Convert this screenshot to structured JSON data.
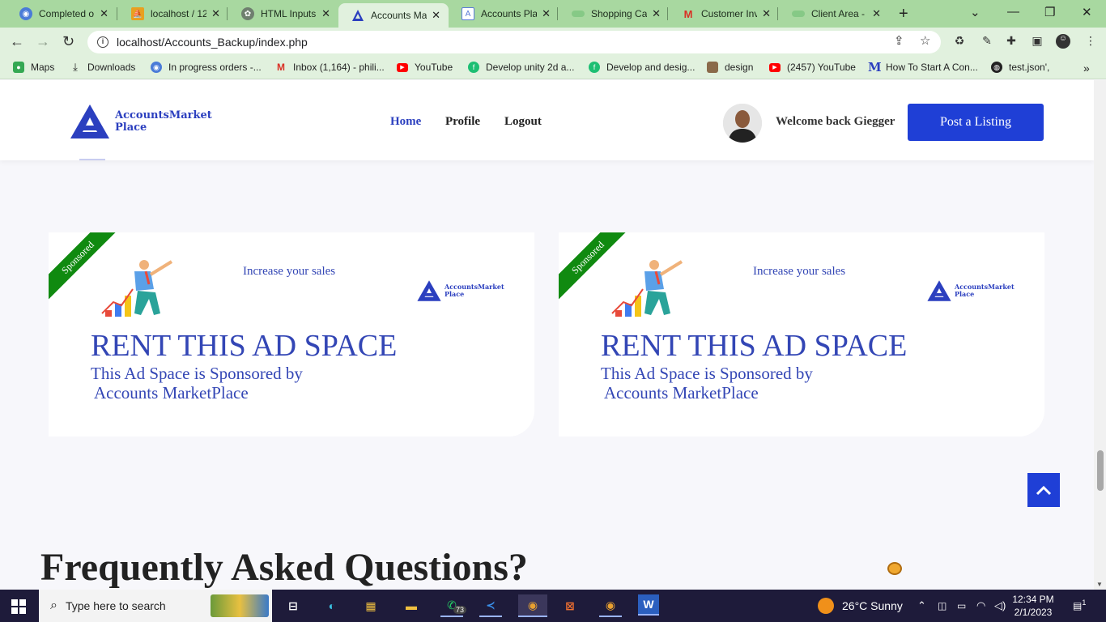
{
  "browser": {
    "tabs": [
      {
        "label": "Completed o",
        "icon": "chat-icon",
        "color": "#4a7bd8"
      },
      {
        "label": "localhost / 12",
        "icon": "phpmyadmin-icon",
        "color": "#e8a020"
      },
      {
        "label": "HTML Inputs",
        "icon": "openai-icon",
        "color": "#6f7f6f"
      },
      {
        "label": "Accounts Ma",
        "icon": "accounts-logo-icon",
        "color": "#2b3fbf"
      },
      {
        "label": "Accounts Pla",
        "icon": "page-icon",
        "color": "#5a7ad8"
      },
      {
        "label": "Shopping Ca",
        "icon": "cloud-icon",
        "color": "#86c986"
      },
      {
        "label": "Customer Inv",
        "icon": "gmail-icon",
        "color": "#d93025"
      },
      {
        "label": "Client Area -",
        "icon": "cloud-icon",
        "color": "#86c986"
      }
    ],
    "active_tab_index": 3,
    "url": "localhost/Accounts_Backup/index.php",
    "bookmarks": [
      {
        "label": "Maps",
        "icon": "maps-icon",
        "color": "#34a853"
      },
      {
        "label": "Downloads",
        "icon": "download-icon",
        "color": "#333333"
      },
      {
        "label": "In progress orders -...",
        "icon": "chat-icon",
        "color": "#4a7bd8"
      },
      {
        "label": "Inbox (1,164) - phili...",
        "icon": "gmail-icon",
        "color": "#d93025"
      },
      {
        "label": "YouTube",
        "icon": "youtube-icon",
        "color": "#ff0000"
      },
      {
        "label": "Develop unity 2d a...",
        "icon": "fiverr-icon",
        "color": "#1dbf73"
      },
      {
        "label": "Develop and desig...",
        "icon": "fiverr-icon",
        "color": "#1dbf73"
      },
      {
        "label": "design",
        "icon": "avatar-icon",
        "color": "#8a6a4a"
      },
      {
        "label": "(2457) YouTube",
        "icon": "youtube-icon",
        "color": "#ff0000"
      },
      {
        "label": "How To Start A Con...",
        "icon": "medium-icon",
        "color": "#2b3fbf"
      },
      {
        "label": "test.json',",
        "icon": "globe-icon",
        "color": "#222222"
      }
    ]
  },
  "site": {
    "logo_line1": "AccountsMarket",
    "logo_line2": "Place",
    "nav": [
      "Home",
      "Profile",
      "Logout"
    ],
    "welcome": "Welcome back Giegger",
    "post_button": "Post a Listing",
    "accent": "#1f3fd6"
  },
  "ads": [
    {
      "ribbon": "Sponsored",
      "tagline": "Increase your sales",
      "logo_line1": "AccountsMarket",
      "logo_line2": "Place",
      "headline": "RENT THIS AD SPACE",
      "sub1": "This Ad Space is Sponsored by",
      "sub2": "Accounts MarketPlace"
    },
    {
      "ribbon": "Sponsored",
      "tagline": "Increase your sales",
      "logo_line1": "AccountsMarket",
      "logo_line2": "Place",
      "headline": "RENT THIS AD SPACE",
      "sub1": "This Ad Space is Sponsored by",
      "sub2": "Accounts MarketPlace"
    }
  ],
  "faq_title": "Frequently Asked Questions?",
  "taskbar": {
    "search_placeholder": "Type here to search",
    "whatsapp_badge": "73",
    "weather": "26°C  Sunny",
    "time": "12:34 PM",
    "date": "2/1/2023",
    "notifications": "1"
  }
}
